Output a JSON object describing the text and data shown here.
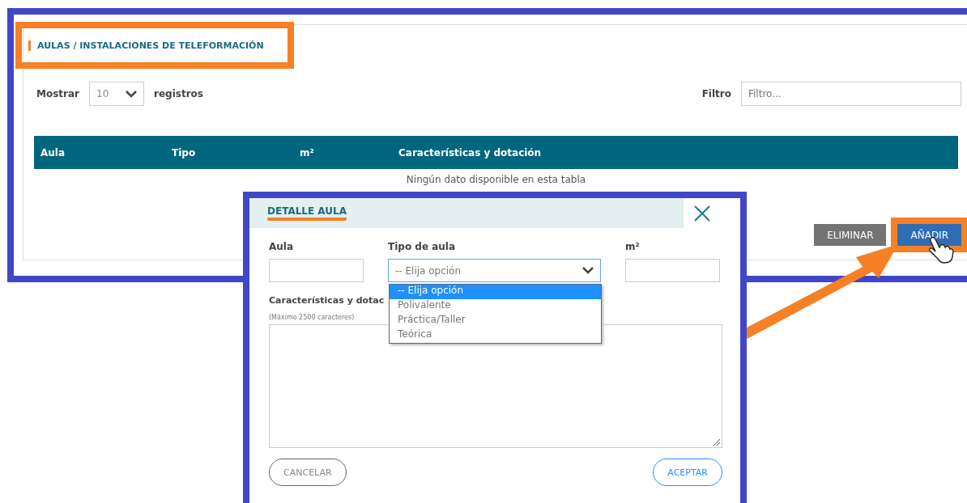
{
  "page": {
    "title": "AULAS / INSTALACIONES DE TELEFORMACIÓN",
    "length_label": "Mostrar",
    "length_value": "10",
    "length_suffix": "registros",
    "filter_label": "Filtro",
    "filter_placeholder": "Filtro...",
    "columns": [
      "Aula",
      "Tipo",
      "m²",
      "Características y dotación"
    ],
    "empty_message": "Ningún dato disponible en esta tabla",
    "buttons": [
      {
        "label": "ELIMINAR",
        "kind": "secondary"
      },
      {
        "label": "AÑADIR",
        "kind": "primary"
      }
    ]
  },
  "dialog": {
    "title": "DETALLE AULA",
    "fields": [
      {
        "label": "Aula",
        "kind": "text"
      },
      {
        "label": "Tipo de aula",
        "kind": "select",
        "value": "-- Elija opción",
        "expanded": true,
        "options": [
          {
            "label": "-- Elija opción",
            "selected": true
          },
          {
            "label": "Polivalente",
            "selected": false
          },
          {
            "label": "Práctica/Taller",
            "selected": false
          },
          {
            "label": "Teórica",
            "selected": false
          }
        ]
      },
      {
        "label": "m²",
        "kind": "text"
      }
    ],
    "notes_label": "Características y dotac",
    "notes_hint": "(Máximo 2500 caracteres)",
    "buttons": [
      {
        "label": "CANCELAR",
        "kind": "secondary"
      },
      {
        "label": "ACEPTAR",
        "kind": "primary"
      }
    ]
  }
}
